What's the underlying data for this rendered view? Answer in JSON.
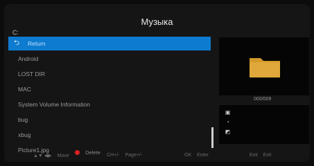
{
  "title": "Музыка",
  "path": "C:",
  "list": [
    {
      "label": "Return",
      "selected": true
    },
    {
      "label": "Android"
    },
    {
      "label": "LOST DIR"
    },
    {
      "label": "MAC"
    },
    {
      "label": "System Volume Information"
    },
    {
      "label": "bug"
    },
    {
      "label": "xbug"
    },
    {
      "label": "Picture1.jpg"
    }
  ],
  "counter": "000/009",
  "action": {
    "delete": "Delete"
  },
  "hints": [
    {
      "keys": "▲▼ ◀▶",
      "label": "Move"
    },
    {
      "keys": "CH+/-",
      "label": "Page+/-"
    },
    {
      "keys": "OK",
      "label": "Enter"
    },
    {
      "keys": "Exit",
      "label": "Exit"
    }
  ],
  "colors": {
    "selection": "#0d7bcf",
    "folder": "#d29a2a",
    "delete": "#e02020"
  },
  "icons": [
    "save-icon",
    "clock-icon",
    "edit-icon"
  ]
}
